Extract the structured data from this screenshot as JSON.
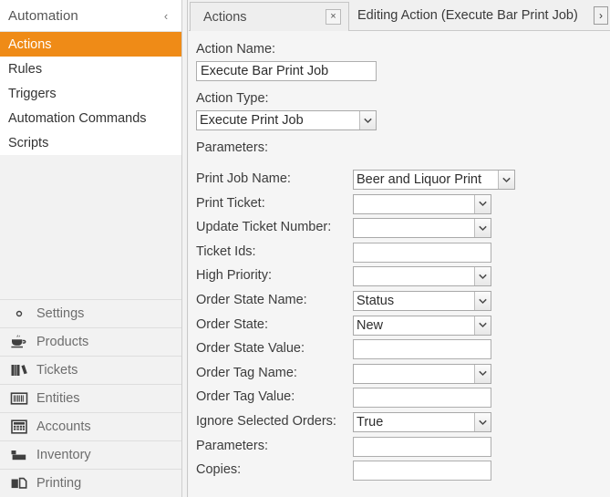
{
  "sidebar": {
    "header_title": "Automation",
    "collapse_icon": "chevron-left-icon",
    "nav_items": [
      {
        "label": "Actions",
        "active": true
      },
      {
        "label": "Rules",
        "active": false
      },
      {
        "label": "Triggers",
        "active": false
      },
      {
        "label": "Automation Commands",
        "active": false
      },
      {
        "label": "Scripts",
        "active": false
      }
    ],
    "categories": [
      {
        "label": "Settings",
        "icon": "gear-icon"
      },
      {
        "label": "Products",
        "icon": "coffee-cup-icon"
      },
      {
        "label": "Tickets",
        "icon": "books-icon"
      },
      {
        "label": "Entities",
        "icon": "barcode-icon"
      },
      {
        "label": "Accounts",
        "icon": "calculator-icon"
      },
      {
        "label": "Inventory",
        "icon": "boxes-icon"
      },
      {
        "label": "Printing",
        "icon": "printer-icon"
      }
    ]
  },
  "tabstrip": {
    "tab_label": "Actions",
    "close_label": "×",
    "active_title": "Editing Action (Execute Bar Print Job)",
    "scroll_right_label": "›"
  },
  "form": {
    "action_name_label": "Action Name:",
    "action_name_value": "Execute Bar Print Job",
    "action_type_label": "Action Type:",
    "action_type_value": "Execute Print Job",
    "parameters_header": "Parameters:",
    "rows": [
      {
        "label": "Print Job Name:",
        "type": "combo",
        "value": "Beer and Liquor Print",
        "wide": true
      },
      {
        "label": "Print Ticket:",
        "type": "combo",
        "value": ""
      },
      {
        "label": "Update Ticket Number:",
        "type": "combo",
        "value": ""
      },
      {
        "label": "Ticket Ids:",
        "type": "text",
        "value": ""
      },
      {
        "label": "High Priority:",
        "type": "combo",
        "value": ""
      },
      {
        "label": "Order State Name:",
        "type": "combo",
        "value": "Status"
      },
      {
        "label": "Order State:",
        "type": "combo",
        "value": "New"
      },
      {
        "label": "Order State Value:",
        "type": "text",
        "value": ""
      },
      {
        "label": "Order Tag Name:",
        "type": "combo",
        "value": ""
      },
      {
        "label": "Order Tag Value:",
        "type": "text",
        "value": ""
      },
      {
        "label": "Ignore Selected Orders:",
        "type": "combo",
        "value": "True"
      },
      {
        "label": "Parameters:",
        "type": "text",
        "value": ""
      },
      {
        "label": "Copies:",
        "type": "text",
        "value": ""
      }
    ]
  },
  "colors": {
    "accent_orange": "#ef8b17",
    "panel_bg": "#f5f5f5",
    "sidebar_bg": "#f2f2f2",
    "field_border": "#aeaeae"
  }
}
